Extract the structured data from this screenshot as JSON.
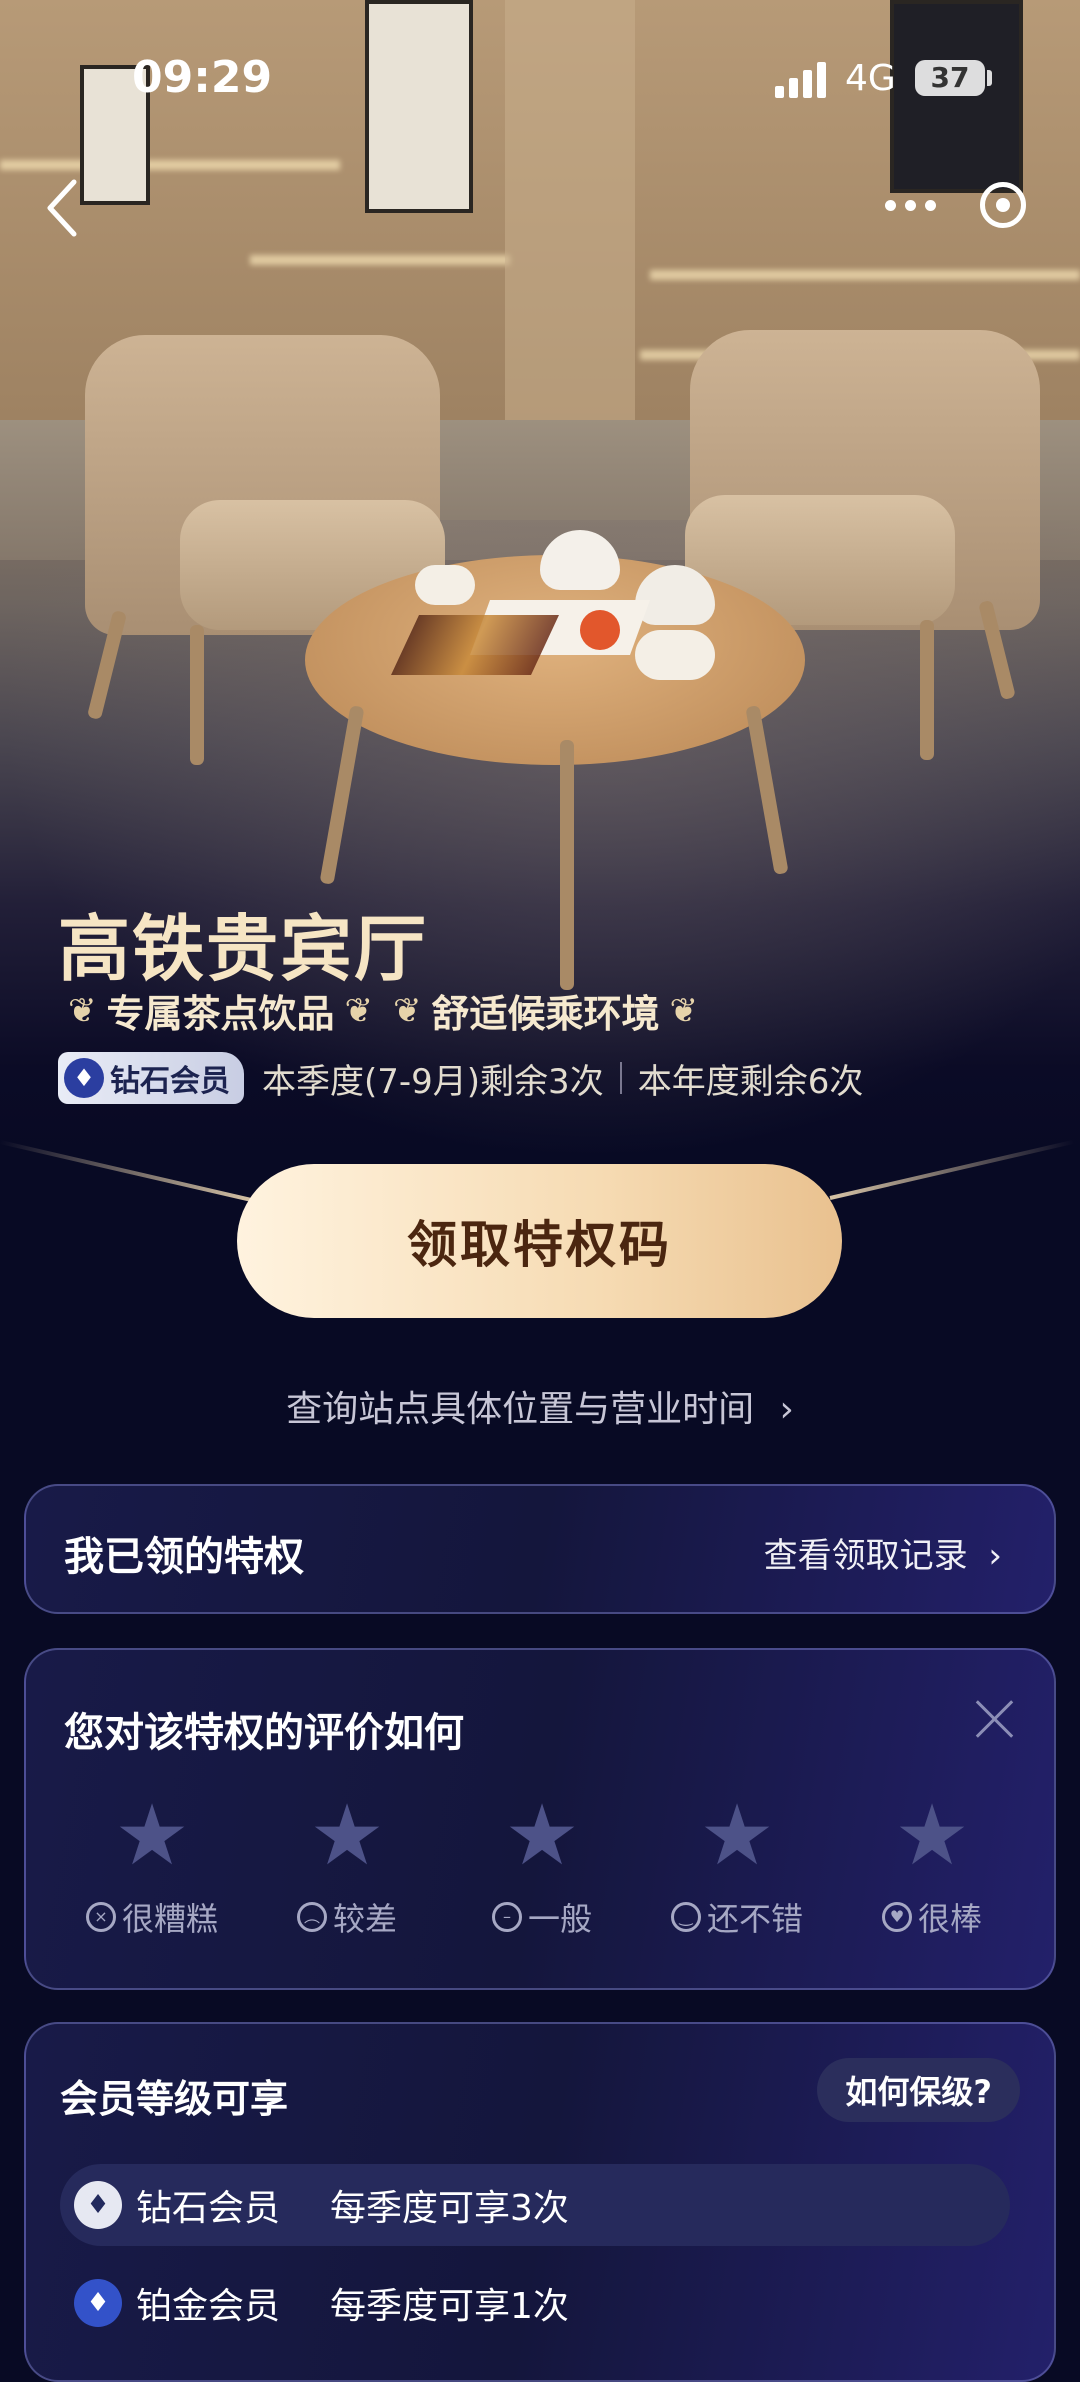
{
  "status_bar": {
    "time": "09:29",
    "network": "4G",
    "battery": "37"
  },
  "hero": {
    "title": "高铁贵宾厅",
    "tags": [
      "专属茶点饮品",
      "舒适候乘环境"
    ]
  },
  "member": {
    "badge": "钻石会员",
    "quarter_remaining": "本季度(7-9月)剩余3次",
    "year_remaining": "本年度剩余6次"
  },
  "cta": {
    "label": "领取特权码"
  },
  "query_link": "查询站点具体位置与营业时间",
  "my_privileges": {
    "title": "我已领的特权",
    "link": "查看领取记录"
  },
  "rating": {
    "title": "您对该特权的评价如何",
    "options": [
      "很糟糕",
      "较差",
      "一般",
      "还不错",
      "很棒"
    ]
  },
  "levels": {
    "title": "会员等级可享",
    "keep_button": "如何保级?",
    "rows": [
      {
        "name": "钻石会员",
        "benefit": "每季度可享3次"
      },
      {
        "name": "铂金会员",
        "benefit": "每季度可享1次"
      }
    ]
  },
  "colors": {
    "background": "#080a24",
    "title_gold": "#f6e5c4",
    "cta_text": "#4b2610",
    "star": "#4d5288"
  },
  "icons": [
    "back-icon",
    "more-icon",
    "target-icon",
    "close-icon",
    "star-icon",
    "chevron-right-icon"
  ]
}
